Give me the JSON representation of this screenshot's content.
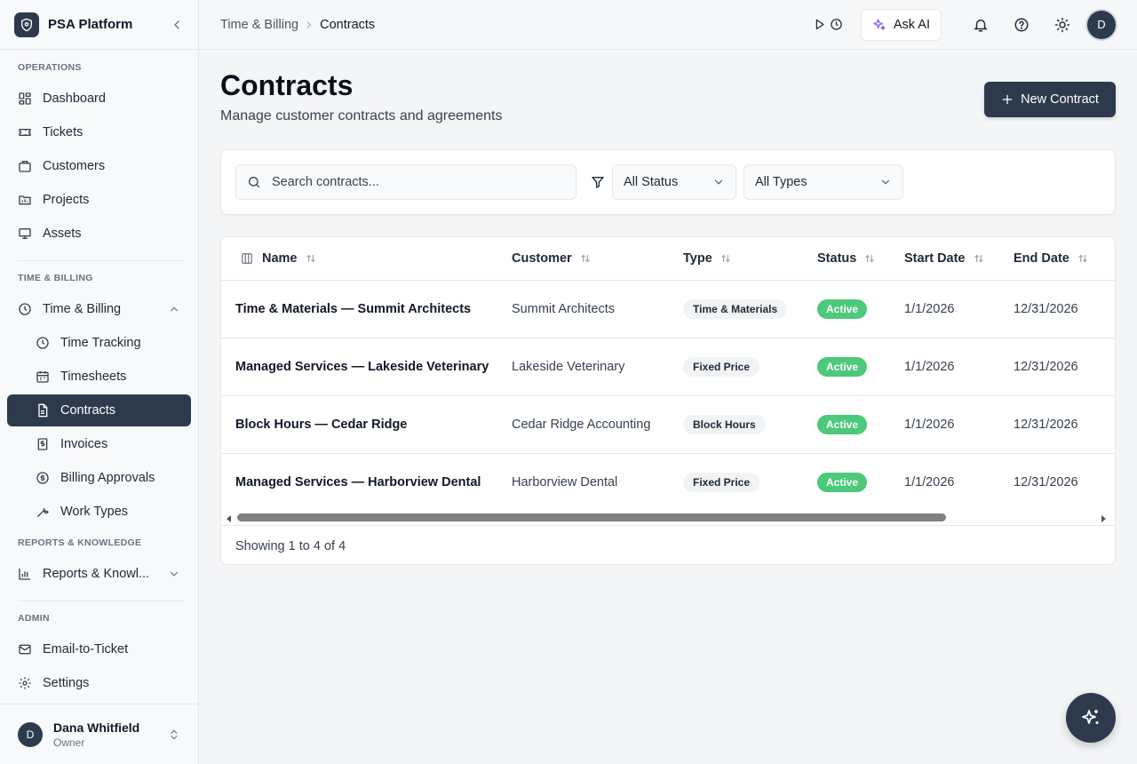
{
  "app": {
    "name": "PSA Platform"
  },
  "sidebar": {
    "sections": {
      "operations": "OPERATIONS",
      "time_billing": "TIME & BILLING",
      "reports": "REPORTS & KNOWLEDGE",
      "admin": "ADMIN"
    },
    "items": {
      "dashboard": "Dashboard",
      "tickets": "Tickets",
      "customers": "Customers",
      "projects": "Projects",
      "assets": "Assets",
      "time_billing": "Time & Billing",
      "time_tracking": "Time Tracking",
      "timesheets": "Timesheets",
      "contracts": "Contracts",
      "invoices": "Invoices",
      "billing_approvals": "Billing Approvals",
      "work_types": "Work Types",
      "reports": "Reports & Knowl...",
      "email_to_ticket": "Email-to-Ticket",
      "settings": "Settings"
    },
    "active_item": "contracts",
    "user": {
      "initial": "D",
      "name": "Dana Whitfield",
      "role": "Owner"
    }
  },
  "header": {
    "breadcrumb": {
      "parent": "Time & Billing",
      "current": "Contracts"
    },
    "ask_ai_label": "Ask AI",
    "avatar_initial": "D"
  },
  "page": {
    "title": "Contracts",
    "subtitle": "Manage customer contracts and agreements",
    "new_button_label": "New Contract"
  },
  "filters": {
    "search_placeholder": "Search contracts...",
    "status_value": "All Status",
    "type_value": "All Types"
  },
  "table": {
    "columns": {
      "name": "Name",
      "customer": "Customer",
      "type": "Type",
      "status": "Status",
      "start": "Start Date",
      "end": "End Date"
    },
    "rows": [
      {
        "name": "Time & Materials — Summit Architects",
        "customer": "Summit Architects",
        "type": "Time & Materials",
        "status": "Active",
        "start": "1/1/2026",
        "end": "12/31/2026"
      },
      {
        "name": "Managed Services — Lakeside Veterinary",
        "customer": "Lakeside Veterinary",
        "type": "Fixed Price",
        "status": "Active",
        "start": "1/1/2026",
        "end": "12/31/2026"
      },
      {
        "name": "Block Hours — Cedar Ridge",
        "customer": "Cedar Ridge Accounting",
        "type": "Block Hours",
        "status": "Active",
        "start": "1/1/2026",
        "end": "12/31/2026"
      },
      {
        "name": "Managed Services — Harborview Dental",
        "customer": "Harborview Dental",
        "type": "Fixed Price",
        "status": "Active",
        "start": "1/1/2026",
        "end": "12/31/2026"
      }
    ],
    "footer": "Showing 1 to 4 of 4"
  },
  "colors": {
    "primary": "#2d3a4e",
    "status_active": "#4cc97a",
    "ai_accent": "#8b5cf6"
  },
  "icons": {
    "brand": "shield-icon",
    "ai": "sparkles-icon",
    "notifications": "bell-icon",
    "help": "help-circle-icon",
    "theme": "sun-icon"
  }
}
